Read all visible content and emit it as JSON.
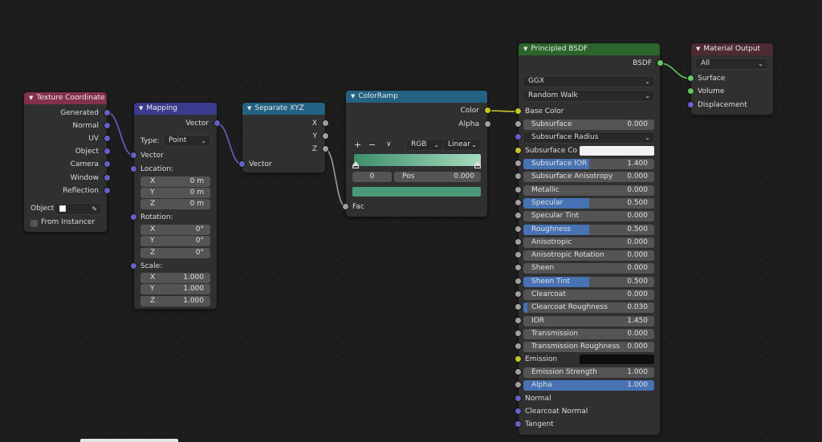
{
  "nodes": {
    "texture_coordinate": {
      "title": "Texture Coordinate",
      "outputs": [
        "Generated",
        "Normal",
        "UV",
        "Object",
        "Camera",
        "Window",
        "Reflection"
      ],
      "object_label": "Object:",
      "from_instancer": "From Instancer"
    },
    "mapping": {
      "title": "Mapping",
      "output": "Vector",
      "type_label": "Type:",
      "type_value": "Point",
      "vector_label": "Vector",
      "location_label": "Location:",
      "location": [
        {
          "axis": "X",
          "value": "0 m"
        },
        {
          "axis": "Y",
          "value": "0 m"
        },
        {
          "axis": "Z",
          "value": "0 m"
        }
      ],
      "rotation_label": "Rotation:",
      "rotation": [
        {
          "axis": "X",
          "value": "0°"
        },
        {
          "axis": "Y",
          "value": "0°"
        },
        {
          "axis": "Z",
          "value": "0°"
        }
      ],
      "scale_label": "Scale:",
      "scale": [
        {
          "axis": "X",
          "value": "1.000"
        },
        {
          "axis": "Y",
          "value": "1.000"
        },
        {
          "axis": "Z",
          "value": "1.000"
        }
      ]
    },
    "separate_xyz": {
      "title": "Separate XYZ",
      "outputs": [
        "X",
        "Y",
        "Z"
      ],
      "input": "Vector"
    },
    "color_ramp": {
      "title": "ColorRamp",
      "outputs": [
        "Color",
        "Alpha"
      ],
      "plus": "+",
      "minus": "−",
      "menu": "∨",
      "color_mode": "RGB",
      "interpolation": "Linear",
      "stop_index": "0",
      "pos_label": "Pos",
      "pos_value": "0.000",
      "input": "Fac",
      "gradient_start": "#3d8f6a",
      "gradient_end": "#a6dcc0",
      "stop_color": "#4a9a7a"
    },
    "principled": {
      "title": "Principled BSDF",
      "output": "BSDF",
      "distribution": "GGX",
      "subsurface_method": "Random Walk",
      "base_color": "Base Color",
      "subsurface": {
        "label": "Subsurface",
        "value": "0.000"
      },
      "subsurface_radius": "Subsurface Radius",
      "subsurface_color": "Subsurface Co",
      "fields": [
        {
          "label": "Subsurface IOR",
          "value": "1.400",
          "fill": 0.5
        },
        {
          "label": "Subsurface Anisotropy",
          "value": "0.000",
          "fill": 0
        },
        {
          "label": "Metallic",
          "value": "0.000",
          "fill": 0
        },
        {
          "label": "Specular",
          "value": "0.500",
          "fill": 0.5
        },
        {
          "label": "Specular Tint",
          "value": "0.000",
          "fill": 0
        },
        {
          "label": "Roughness",
          "value": "0.500",
          "fill": 0.5
        },
        {
          "label": "Anisotropic",
          "value": "0.000",
          "fill": 0
        },
        {
          "label": "Anisotropic Rotation",
          "value": "0.000",
          "fill": 0
        },
        {
          "label": "Sheen",
          "value": "0.000",
          "fill": 0
        },
        {
          "label": "Sheen Tint",
          "value": "0.500",
          "fill": 0.5
        },
        {
          "label": "Clearcoat",
          "value": "0.000",
          "fill": 0
        },
        {
          "label": "Clearcoat Roughness",
          "value": "0.030",
          "fill": 0.03
        },
        {
          "label": "IOR",
          "value": "1.450",
          "fill": 0
        },
        {
          "label": "Transmission",
          "value": "0.000",
          "fill": 0
        },
        {
          "label": "Transmission Roughness",
          "value": "0.000",
          "fill": 0
        }
      ],
      "emission": "Emission",
      "emission_strength": {
        "label": "Emission Strength",
        "value": "1.000"
      },
      "alpha": {
        "label": "Alpha",
        "value": "1.000",
        "fill": 1
      },
      "normal": "Normal",
      "clearcoat_normal": "Clearcoat Normal",
      "tangent": "Tangent"
    },
    "material_output": {
      "title": "Material Output",
      "target": "All",
      "inputs": [
        "Surface",
        "Volume",
        "Displacement"
      ]
    }
  },
  "colors": {
    "header_input": "#83314a",
    "header_vector": "#3b3b8f",
    "header_converter": "#246283",
    "header_shader": "#2b652b",
    "header_output": "#4e2a32",
    "wire": "#8f8f8f",
    "wire_vector": "#6363c7",
    "wire_color": "#c7c729",
    "wire_shader": "#63c763"
  }
}
